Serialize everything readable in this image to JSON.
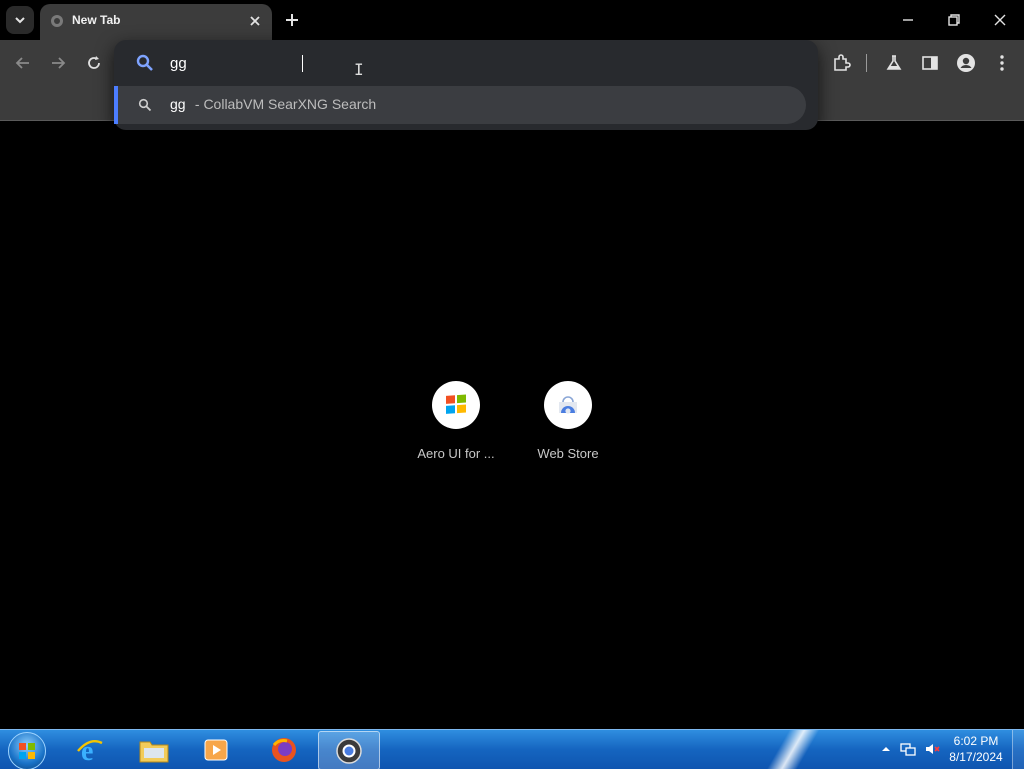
{
  "tab": {
    "title": "New Tab"
  },
  "omnibox": {
    "value": "gg",
    "suggestion": {
      "query": "gg",
      "description": " - CollabVM SearXNG Search"
    }
  },
  "shortcuts": [
    {
      "label": "Aero UI for ..."
    },
    {
      "label": "Web Store"
    }
  ],
  "taskbar": {
    "apps": [
      "start-orb",
      "internet-explorer-icon",
      "file-explorer-icon",
      "media-player-icon",
      "firefox-icon",
      "chrome-icon"
    ],
    "active_app": "chrome-icon",
    "clock": {
      "time": "6:02 PM",
      "date": "8/17/2024"
    }
  },
  "colors": {
    "accent": "#4c7dff",
    "taskbar": "#1565c0",
    "toolbar": "#3c3c3c"
  }
}
